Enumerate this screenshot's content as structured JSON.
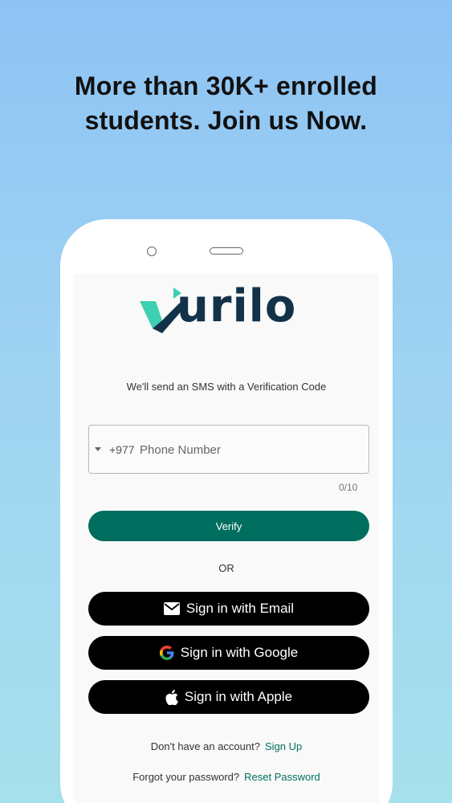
{
  "headline": {
    "line1": "More than 30K+ enrolled",
    "line2": "students. Join us Now."
  },
  "logo": {
    "text": "urilo",
    "icon": "vurilo-v-play-logo-icon"
  },
  "sms_text": "We'll send an SMS with a Verification Code",
  "phone_field": {
    "country_code": "+977",
    "placeholder": "Phone Number",
    "value": "",
    "counter": "0/10"
  },
  "verify_label": "Verify",
  "or_label": "OR",
  "sso": {
    "email_label": "Sign in with Email",
    "google_label": "Sign in with Google",
    "apple_label": "Sign in with Apple"
  },
  "footer": {
    "no_account": "Don't have an account?",
    "signup_label": "Sign Up",
    "forgot": "Forgot your password?",
    "reset_label": "Reset Password"
  },
  "colors": {
    "accent": "#006e5e",
    "logo_teal": "#3ecfb2",
    "logo_navy": "#12324a"
  }
}
